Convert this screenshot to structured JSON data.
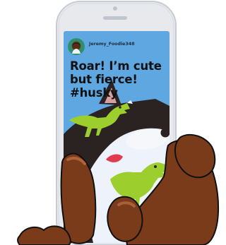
{
  "post": {
    "username": "Jeremy_Foodie348",
    "caption_lines": [
      "Roar! I’m cute",
      "but fierce!",
      "#husky"
    ]
  },
  "colors": {
    "phone_frame": "#e7e9ed",
    "phone_edge": "#c6cbd4",
    "screen_bg": "#5ea7e1",
    "husky_dark": "#2a2322",
    "husky_light": "#eef3fb",
    "dino_green": "#9ccf2e",
    "hand_skin": "#7a3b1b"
  },
  "icons": [
    "camera-icon",
    "speaker-icon",
    "avatar-icon"
  ]
}
